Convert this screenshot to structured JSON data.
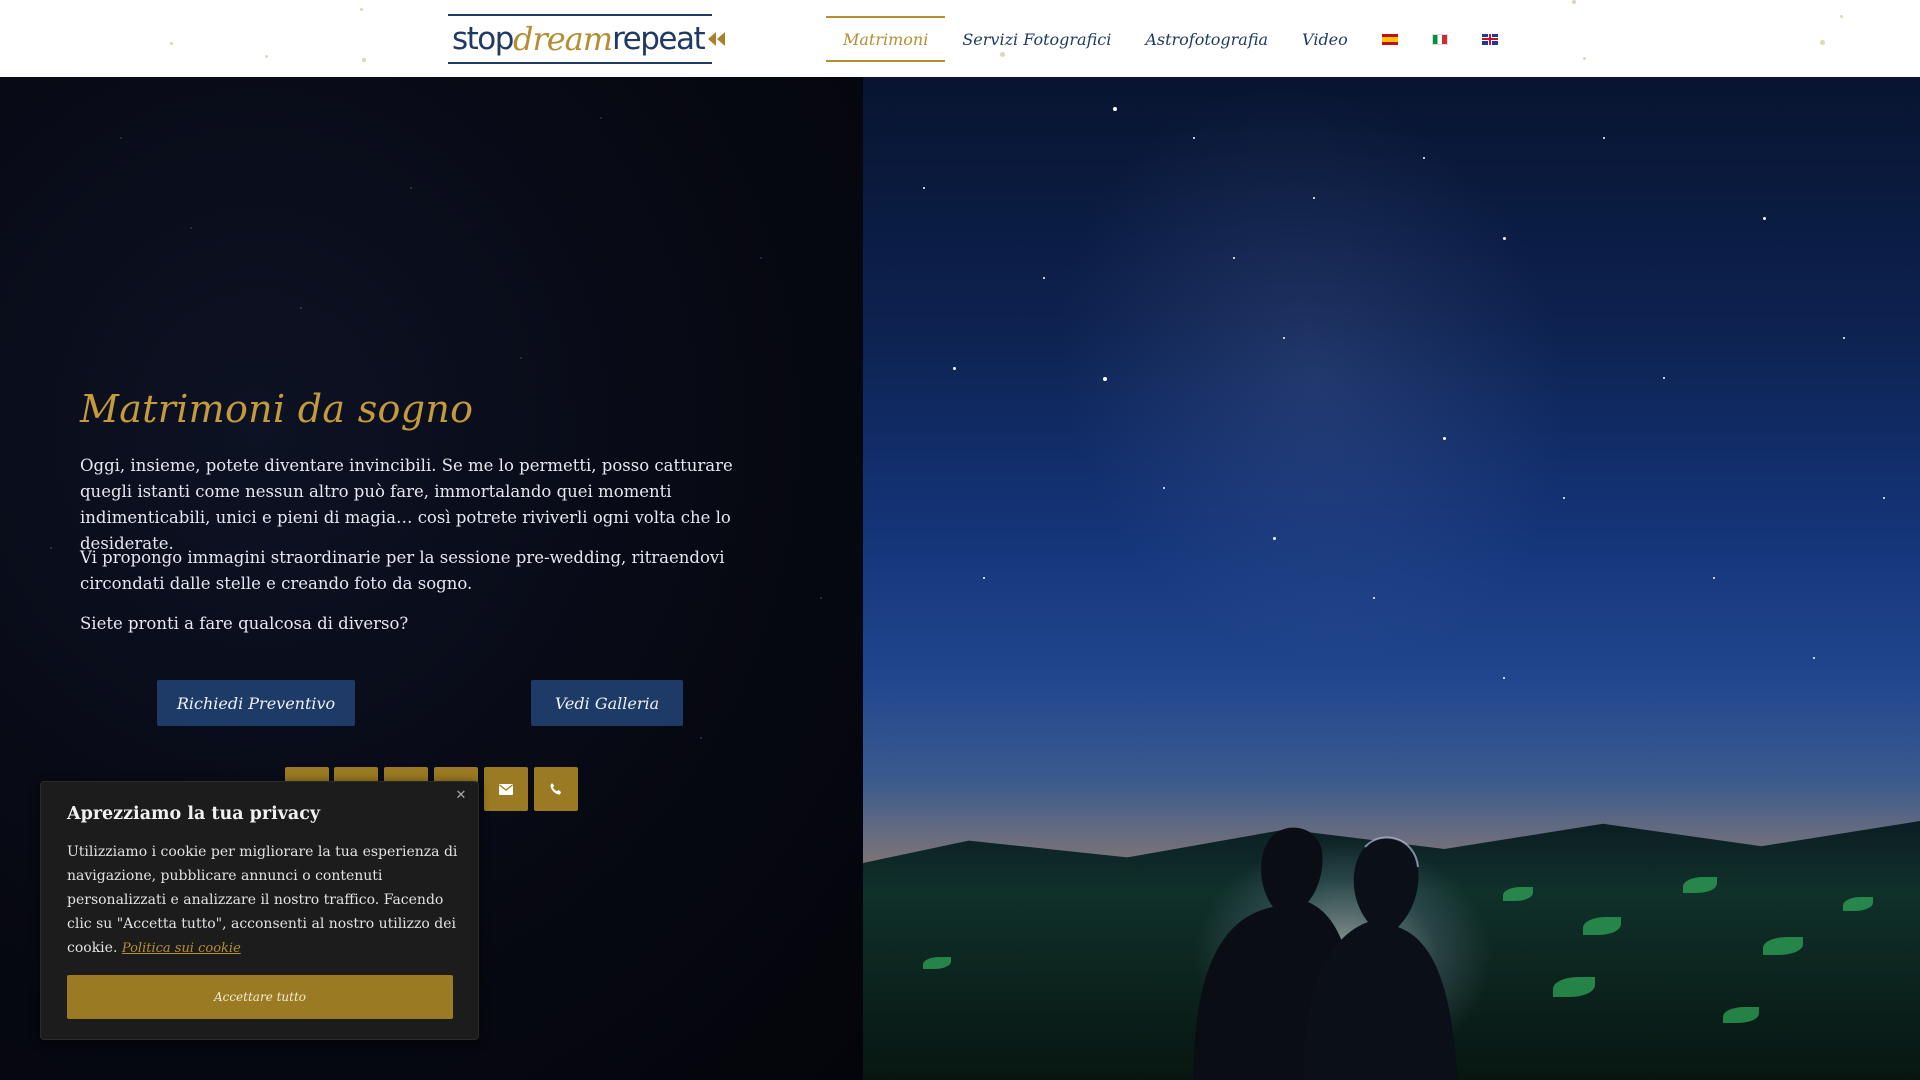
{
  "header": {
    "logo": {
      "part1": "stop",
      "part2": "dream",
      "part3": "repeat"
    },
    "nav": [
      {
        "label": "Matrimoni",
        "active": true
      },
      {
        "label": "Servizi Fotografici",
        "active": false
      },
      {
        "label": "Astrofotografia",
        "active": false
      },
      {
        "label": "Video",
        "active": false
      }
    ],
    "languages": [
      {
        "code": "es",
        "icon": "flag-es-icon"
      },
      {
        "code": "it",
        "icon": "flag-it-icon"
      },
      {
        "code": "en",
        "icon": "flag-en-icon"
      }
    ]
  },
  "hero": {
    "title": "Matrimoni da sogno",
    "paragraphs": [
      "Oggi, insieme, potete diventare invincibili. Se me lo permetti, posso catturare quegli istanti come nessun altro può fare, immortalando quei momenti indimenticabili, unici e pieni di magia… così potrete riviverli ogni volta che lo desiderate.",
      "Vi propongo immagini straordinarie per la sessione pre-wedding, ritraendovi circondati dalle stelle e creando foto da sogno.",
      "Siete pronti a fare qualcosa di diverso?"
    ],
    "buttons": {
      "quote": "Richiedi Preventivo",
      "gallery": "Vedi Galleria"
    },
    "social": [
      {
        "icon": "facebook-icon"
      },
      {
        "icon": "instagram-icon"
      },
      {
        "icon": "youtube-icon"
      },
      {
        "icon": "whatsapp-icon"
      },
      {
        "icon": "envelope-icon"
      },
      {
        "icon": "phone-icon"
      }
    ]
  },
  "cookie": {
    "title": "Aprezziamo la tua privacy",
    "text": "Utilizziamo i cookie per migliorare la tua esperienza di navigazione, pubblicare annunci o contenuti personalizzati e analizzare il nostro traffico. Facendo clic su \"Accetta tutto\", acconsenti al nostro utilizzo dei cookie.",
    "link": "Politica sui cookie",
    "accept": "Accettare tutto"
  },
  "colors": {
    "gold": "#b58d33",
    "navy": "#1f3a63",
    "button": "#1e3a66",
    "social": "#9a7a22"
  }
}
